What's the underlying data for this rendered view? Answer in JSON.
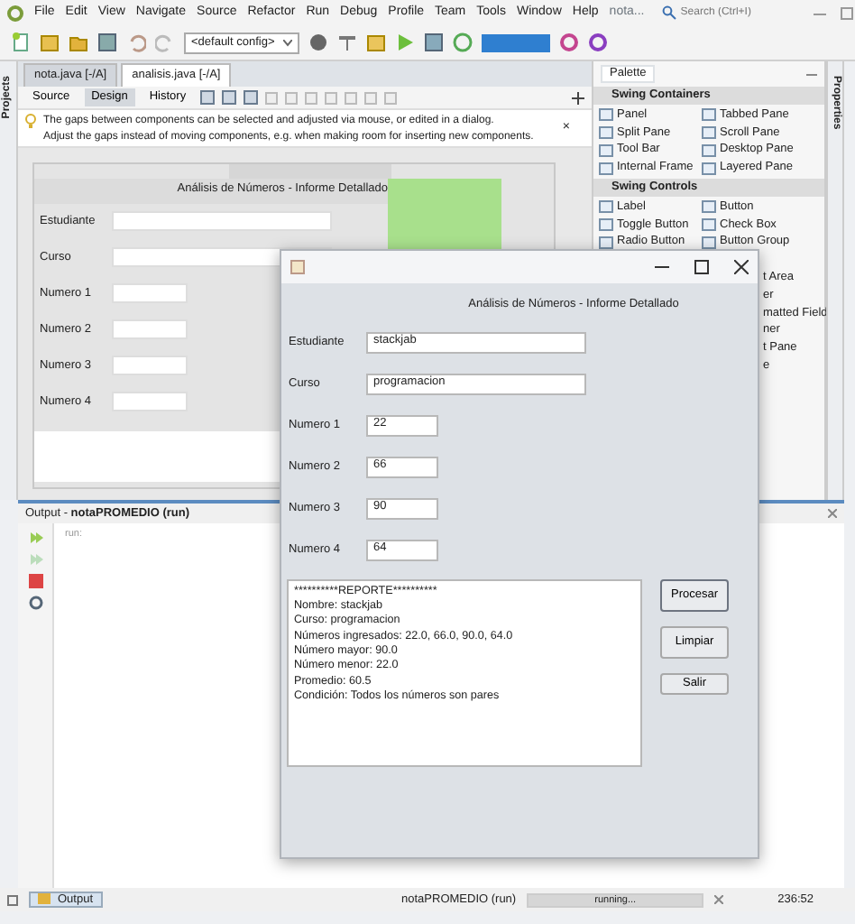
{
  "ide": {
    "menu": [
      "File",
      "Edit",
      "View",
      "Navigate",
      "Source",
      "Refactor",
      "Run",
      "Debug",
      "Profile",
      "Team",
      "Tools",
      "Window",
      "Help"
    ],
    "project_hint": "nota...",
    "search": {
      "placeholder": "Search (Ctrl+I)"
    },
    "config": "<default config>"
  },
  "editor_tabs": [
    {
      "label": "nota.java [-/A]",
      "selected": false
    },
    {
      "label": "analisis.java [-/A]",
      "selected": true
    }
  ],
  "views": [
    {
      "label": "Source",
      "selected": false
    },
    {
      "label": "Design",
      "selected": true
    },
    {
      "label": "History",
      "selected": false
    }
  ],
  "hint": {
    "lines": [
      "The gaps between components can be selected and adjusted via mouse, or edited in a dialog.",
      "Adjust the gaps instead of moving components, e.g. when making room for inserting new components."
    ],
    "close": "×"
  },
  "side_left": "Projects",
  "side_right": "Properties",
  "form_preview": {
    "title": "Análisis de Números - Informe Detallado",
    "labels": [
      "Estudiante",
      "Curso",
      "Numero 1",
      "Numero 2",
      "Numero 3",
      "Numero 4"
    ]
  },
  "palette": {
    "title": "Palette",
    "sections": [
      {
        "title": "Swing Containers",
        "items": [
          {
            "label": "Panel",
            "kind": "full"
          },
          {
            "label": "Tabbed Pane",
            "kind": "full"
          },
          {
            "label": "Split Pane",
            "kind": "full"
          },
          {
            "label": "Scroll Pane",
            "kind": "full"
          },
          {
            "label": "Tool Bar",
            "kind": "full"
          },
          {
            "label": "Desktop Pane",
            "kind": "full"
          },
          {
            "label": "Internal Frame",
            "kind": "full"
          },
          {
            "label": "Layered Pane",
            "kind": "full"
          }
        ]
      },
      {
        "title": "Swing Controls",
        "items": [
          {
            "label": "Label",
            "kind": "full"
          },
          {
            "label": "Button",
            "kind": "full"
          },
          {
            "label": "Toggle Button",
            "kind": "full"
          },
          {
            "label": "Check Box",
            "kind": "full"
          },
          {
            "label": "Radio Button",
            "kind": "full"
          },
          {
            "label": "Button Group",
            "kind": "full"
          },
          {
            "label": "t Area",
            "kind": "partial"
          },
          {
            "label": "er",
            "kind": "partial"
          },
          {
            "label": "matted Field",
            "kind": "partial"
          },
          {
            "label": "ner",
            "kind": "partial"
          },
          {
            "label": "t Pane",
            "kind": "partial"
          },
          {
            "label": "e",
            "kind": "partial"
          }
        ]
      }
    ]
  },
  "output": {
    "title": "Output - **notaPROMEDIO (run)**",
    "lines": [
      "run:"
    ]
  },
  "status_bar": {
    "output_tab": "Output",
    "task": "notaPROMEDIO (run)",
    "progress": {
      "label": "running...",
      "level": 1
    },
    "position": "236:52"
  },
  "dialog": {
    "title": "Análisis de Números - Informe Detallado",
    "fields": [
      {
        "label": "Estudiante",
        "value": "stackjab",
        "kind": "wide"
      },
      {
        "label": "Curso",
        "value": "programacion",
        "kind": "wide"
      },
      {
        "label": "Numero 1",
        "value": "22",
        "kind": "short"
      },
      {
        "label": "Numero 2",
        "value": "66",
        "kind": "short"
      },
      {
        "label": "Numero 3",
        "value": "90",
        "kind": "short"
      },
      {
        "label": "Numero 4",
        "value": "64",
        "kind": "short"
      }
    ],
    "report": [
      "**********REPORTE**********",
      "Nombre: stackjab",
      "Curso: programacion",
      "Números ingresados: 22.0, 66.0, 90.0, 64.0",
      "Número mayor: 90.0",
      "Número menor: 22.0",
      "Promedio: 60.5",
      "Condición: Todos los números son pares"
    ],
    "buttons": [
      {
        "label": "Procesar",
        "focused": true
      },
      {
        "label": "Limpiar",
        "focused": false
      },
      {
        "label": "Salir",
        "focused": false
      }
    ]
  }
}
